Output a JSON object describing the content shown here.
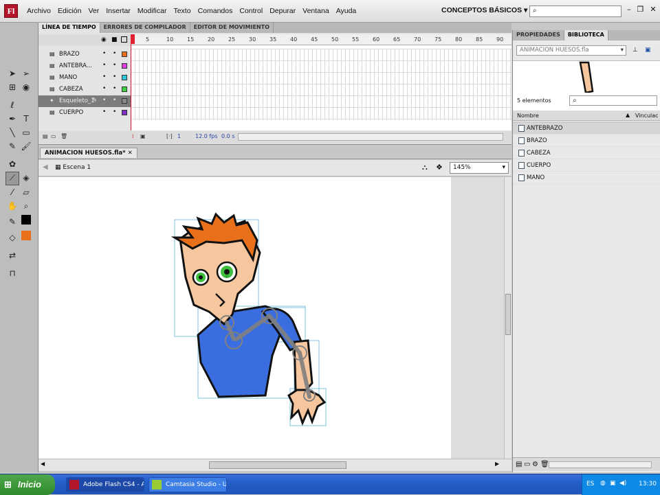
{
  "menubar": {
    "logo": "Fl",
    "menus": [
      "Archivo",
      "Edición",
      "Ver",
      "Insertar",
      "Modificar",
      "Texto",
      "Comandos",
      "Control",
      "Depurar",
      "Ventana",
      "Ayuda"
    ],
    "workspace": "CONCEPTOS BÁSICOS"
  },
  "timeline": {
    "tabs": [
      "LÍNEA DE TIEMPO",
      "ERRORES DE COMPILADOR",
      "EDITOR DE MOVIMIENTO"
    ],
    "layers": [
      {
        "name": "BRAZO",
        "color": "#e8701a"
      },
      {
        "name": "ANTEBRA...",
        "color": "#e040e0"
      },
      {
        "name": "MANO",
        "color": "#30c8d8"
      },
      {
        "name": "CABEZA",
        "color": "#40d040"
      },
      {
        "name": "Esqueleto_1",
        "color": "#8a8a8a"
      },
      {
        "name": "CUERPO",
        "color": "#8030c0"
      }
    ],
    "ruler": [
      "5",
      "10",
      "15",
      "20",
      "25",
      "30",
      "35",
      "40",
      "45",
      "50",
      "55",
      "60",
      "65",
      "70",
      "75",
      "80",
      "85",
      "90"
    ],
    "footer": {
      "frame": "1",
      "fps": "12.0 fps",
      "time": "0.0 s"
    }
  },
  "document": {
    "tab": "ANIMACION HUESOS.fla*",
    "scene": "Escena 1",
    "zoom": "145%"
  },
  "library": {
    "tabs": [
      "PROPIEDADES",
      "BIBLIOTECA"
    ],
    "file": "ANIMACION HUESOS.fla",
    "count": "5 elementos",
    "col_name": "Nombre",
    "col_link": "Vinculac",
    "items": [
      "ANTEBRAZO",
      "BRAZO",
      "CABEZA",
      "CUERPO",
      "MANO"
    ]
  },
  "taskbar": {
    "start": "Inicio",
    "tasks": [
      "Adobe Flash CS4 - A...",
      "Camtasia Studio - Unt..."
    ],
    "lang": "ES",
    "clock": "13:30"
  }
}
